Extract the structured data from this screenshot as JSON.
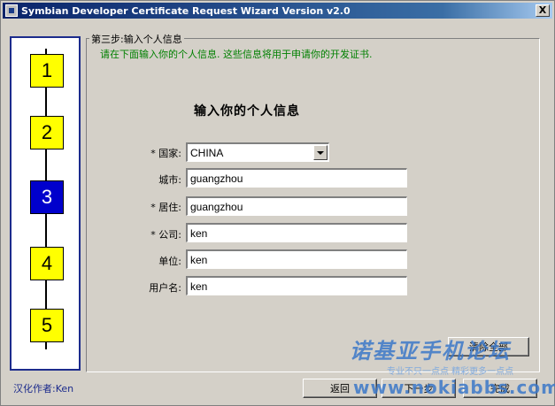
{
  "window": {
    "title": "Symbian Developer Certificate Request Wizard Version v2.0",
    "close_label": "X"
  },
  "steps": [
    "1",
    "2",
    "3",
    "4",
    "5"
  ],
  "active_step": 3,
  "group": {
    "title": "第三步:输入个人信息",
    "subtitle": "请在下面输入你的个人信息. 这些信息将用于申请你的开发证书."
  },
  "form": {
    "heading": "输入你的个人信息",
    "country": {
      "label": "* 国家:",
      "value": "CHINA"
    },
    "city": {
      "label": "城市:",
      "value": "guangzhou"
    },
    "residence": {
      "label": "* 居住:",
      "value": "guangzhou"
    },
    "company": {
      "label": "* 公司:",
      "value": "ken"
    },
    "unit": {
      "label": "单位:",
      "value": "ken"
    },
    "username": {
      "label": "用户名:",
      "value": "ken"
    }
  },
  "buttons": {
    "clear_all": "清除全部",
    "back": "返回",
    "next": "下一步",
    "finish": "完成"
  },
  "author": "汉化作者:Ken",
  "watermark": {
    "title": "诺基亚手机论坛",
    "slogan": "专业不只一点点 精彩更多一点点",
    "url": "www.nokiabbs.com"
  }
}
